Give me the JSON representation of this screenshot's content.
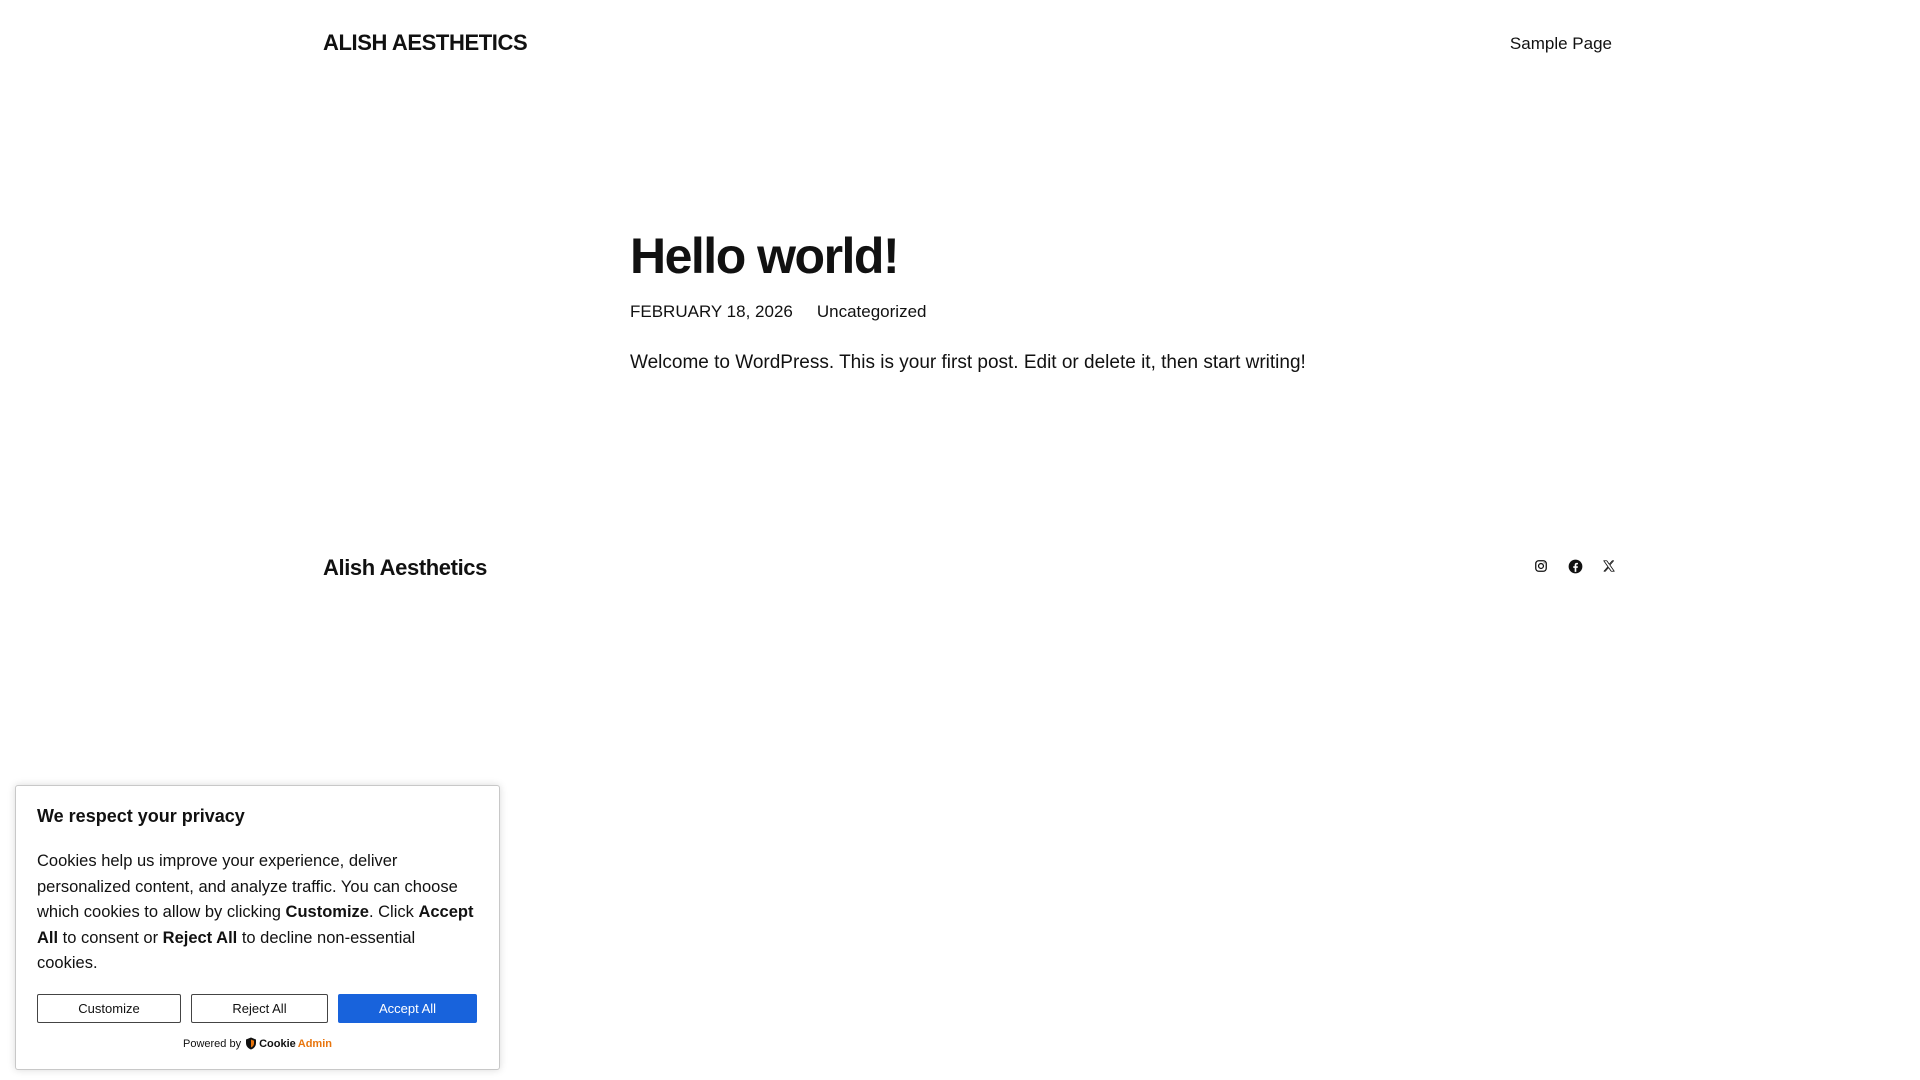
{
  "header": {
    "site_title": "ALISH AESTHETICS",
    "nav": [
      {
        "label": "Sample Page"
      }
    ]
  },
  "post": {
    "title": "Hello world!",
    "date": "February 18, 2026",
    "category": "Uncategorized",
    "content": "Welcome to WordPress. This is your first post. Edit or delete it, then start writing!"
  },
  "footer": {
    "title": "Alish Aesthetics",
    "social_icons": [
      "instagram-icon",
      "facebook-icon",
      "x-icon"
    ]
  },
  "cookie": {
    "title": "We respect your privacy",
    "text_part1": "Cookies help us improve your experience, deliver personalized content, and analyze traffic. You can choose which cookies to allow by clicking ",
    "bold_customize": "Customize",
    "text_part2": ". Click ",
    "bold_accept": "Accept All",
    "text_part3": " to consent or ",
    "bold_reject": "Reject All",
    "text_part4": " to decline non-essential cookies.",
    "btn_customize": "Customize",
    "btn_reject": "Reject All",
    "btn_accept": "Accept All",
    "powered_by": "Powered by",
    "brand_part1": "Cookie",
    "brand_part2": "Admin",
    "accept_color": "#1863dc",
    "brand_color": "#e8750d"
  }
}
